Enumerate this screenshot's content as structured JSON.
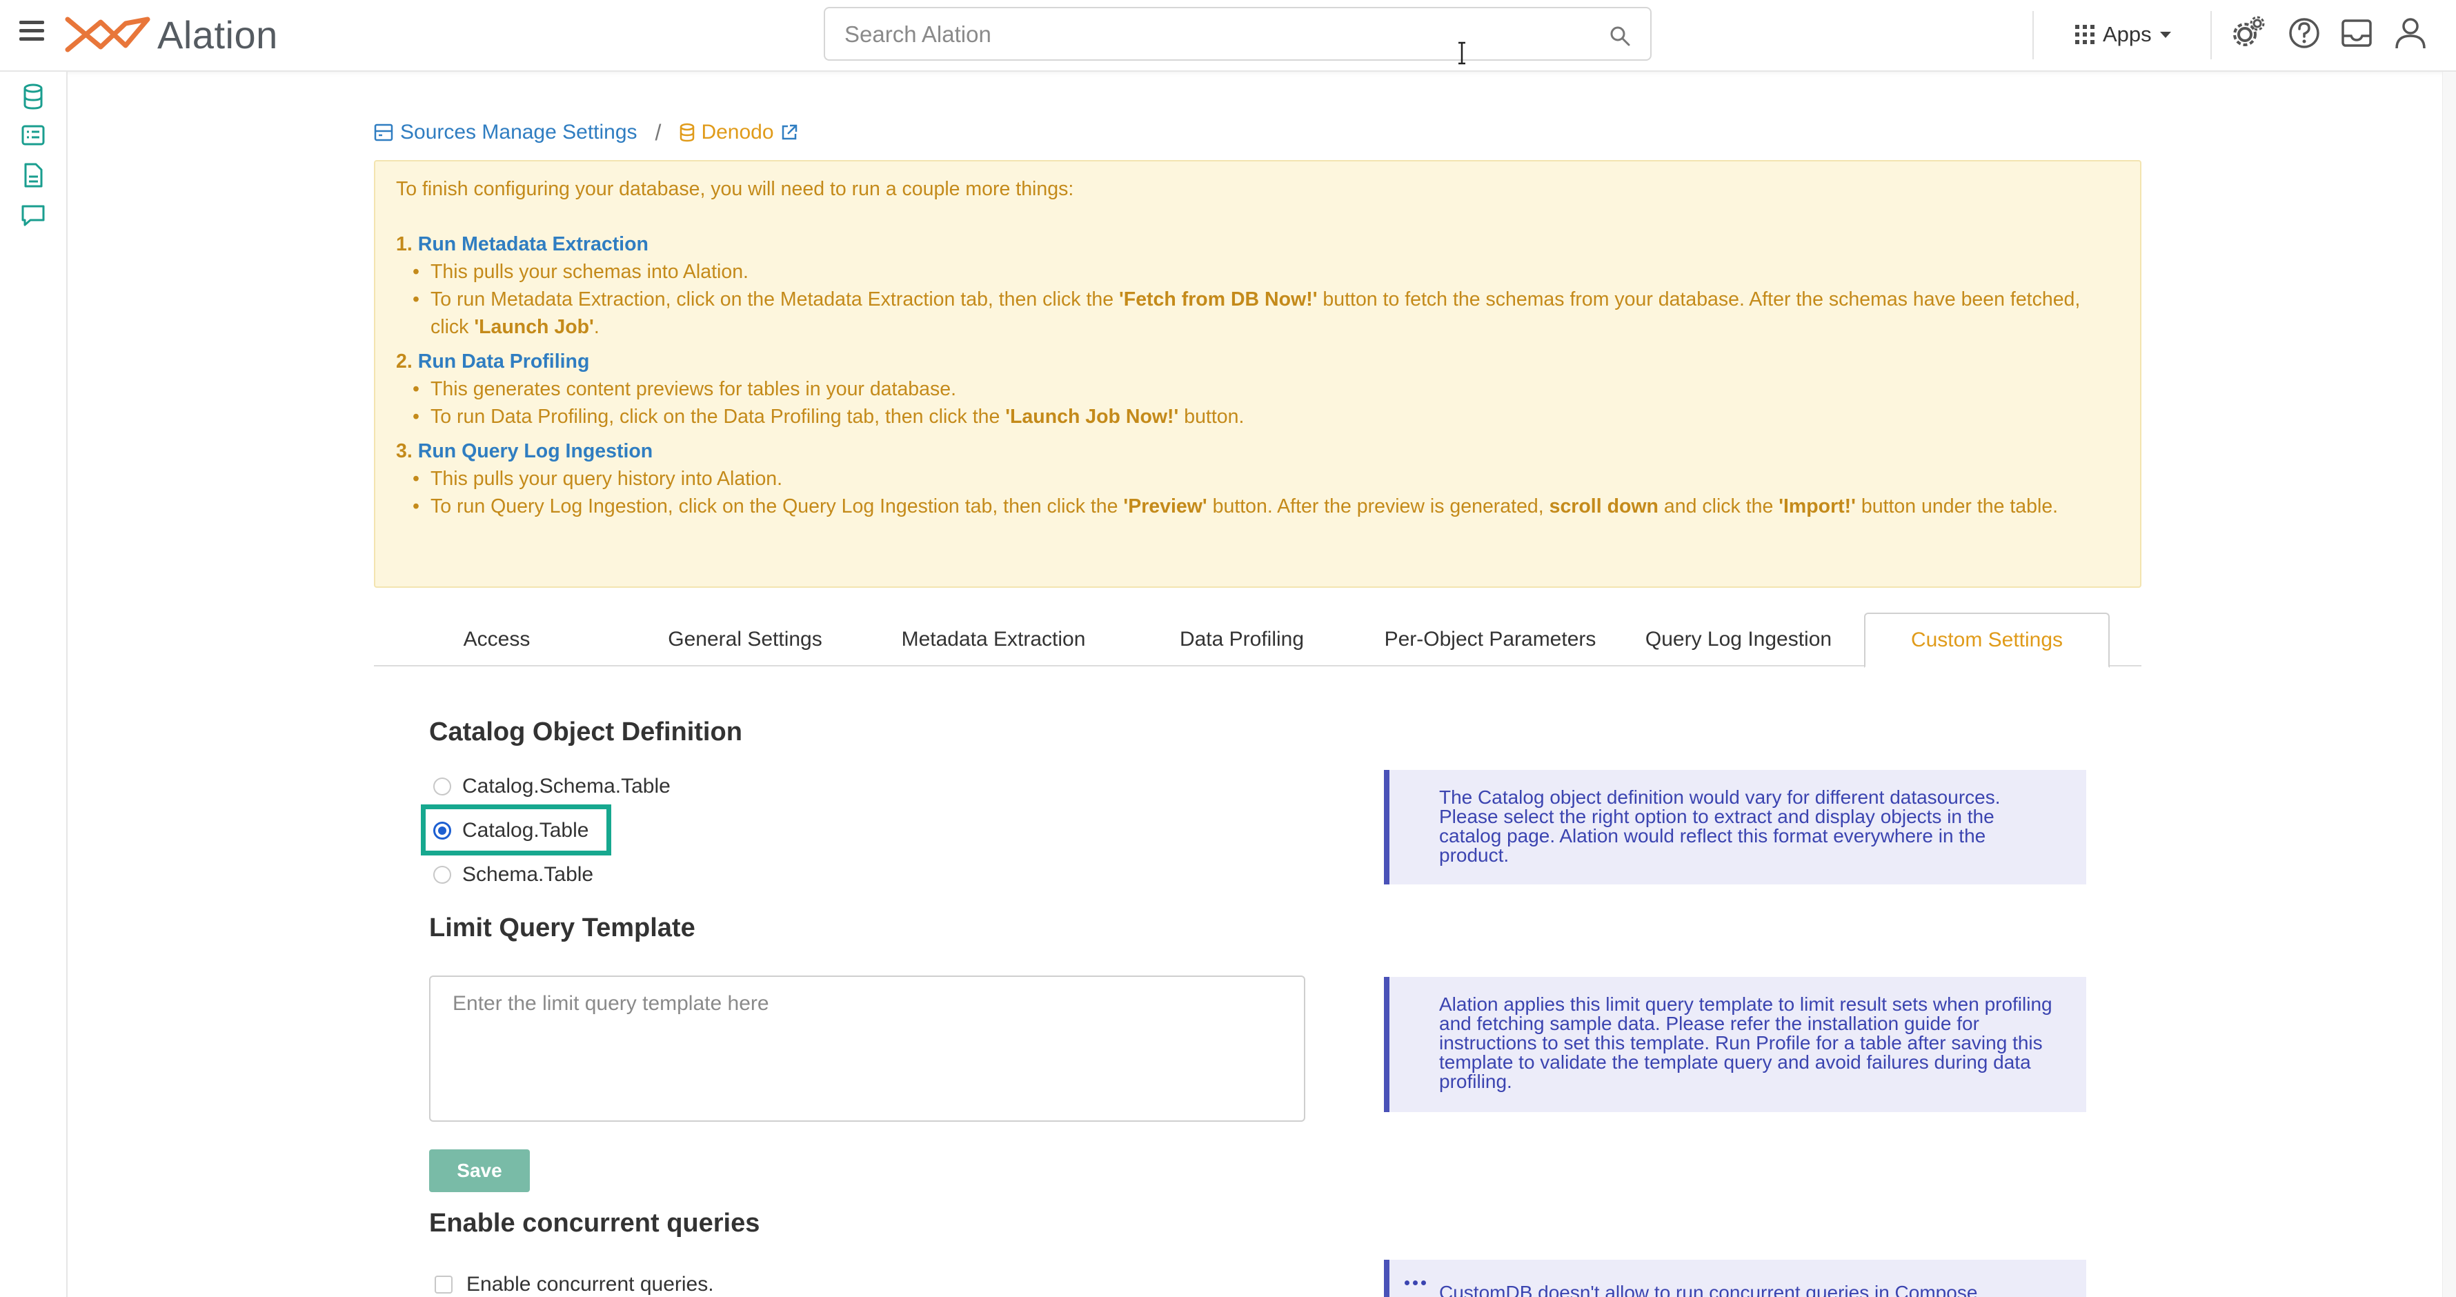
{
  "header": {
    "logo_text": "Alation",
    "search_placeholder": "Search Alation",
    "apps_label": "Apps"
  },
  "breadcrumb": {
    "section": "Sources Manage Settings",
    "separator": "/",
    "datasource": "Denodo"
  },
  "notice": {
    "intro": "To finish configuring your database, you will need to run a couple more things:",
    "steps": [
      {
        "number": "1.",
        "title": "Run Metadata Extraction",
        "b1": "This pulls your schemas into Alation.",
        "b2_pre": "To run Metadata Extraction, click on the Metadata Extraction tab, then click the ",
        "b2_bold1": "'Fetch from DB Now!'",
        "b2_mid": " button to fetch the schemas from your database. After the schemas have been fetched, click ",
        "b2_bold2": "'Launch Job'",
        "b2_post": "."
      },
      {
        "number": "2.",
        "title": "Run Data Profiling",
        "b1": "This generates content previews for tables in your database.",
        "b2_pre": "To run Data Profiling, click on the Data Profiling tab, then click the ",
        "b2_bold1": "'Launch Job Now!'",
        "b2_post": " button."
      },
      {
        "number": "3.",
        "title": "Run Query Log Ingestion",
        "b1": "This pulls your query history into Alation.",
        "b2_pre": "To run Query Log Ingestion, click on the Query Log Ingestion tab, then click the ",
        "b2_bold1": "'Preview'",
        "b2_mid1": " button. After the preview is generated, ",
        "b2_bold2": "scroll down",
        "b2_mid2": " and click the ",
        "b2_bold3": "'Import!'",
        "b2_post": " button under the table."
      }
    ]
  },
  "tabs": [
    {
      "label": "Access"
    },
    {
      "label": "General Settings"
    },
    {
      "label": "Metadata Extraction"
    },
    {
      "label": "Data Profiling"
    },
    {
      "label": "Per-Object Parameters"
    },
    {
      "label": "Query Log Ingestion"
    },
    {
      "label": "Custom Settings",
      "active": true
    }
  ],
  "catalog_def": {
    "title": "Catalog Object Definition",
    "options": [
      "Catalog.Schema.Table",
      "Catalog.Table",
      "Schema.Table"
    ],
    "selected": "Catalog.Table",
    "info": "The Catalog object definition would vary for different datasources. Please select the right option to extract and display objects in the catalog page. Alation would reflect this format everywhere in the product."
  },
  "limit_query": {
    "title": "Limit Query Template",
    "placeholder": "Enter the limit query template here",
    "info": "Alation applies this limit query template to limit result sets when profiling and fetching sample data. Please refer the installation guide for instructions to set this template. Run Profile for a table after saving this template to validate the template query and avoid failures during data profiling.",
    "save_label": "Save"
  },
  "concurrent": {
    "title": "Enable concurrent queries",
    "checkbox_label": "Enable concurrent queries.",
    "info": "CustomDB doesn't allow to run concurrent queries in Compose"
  },
  "colors": {
    "brand_orange": "#e8763a",
    "link_blue": "#2f7dc1",
    "accent_amber": "#e09b1a",
    "notice_bg": "#fdf6dd",
    "info_bg": "#ececf9",
    "info_border": "#4a52b8",
    "highlight_teal": "#17a88f",
    "save_green": "#79bba7"
  }
}
